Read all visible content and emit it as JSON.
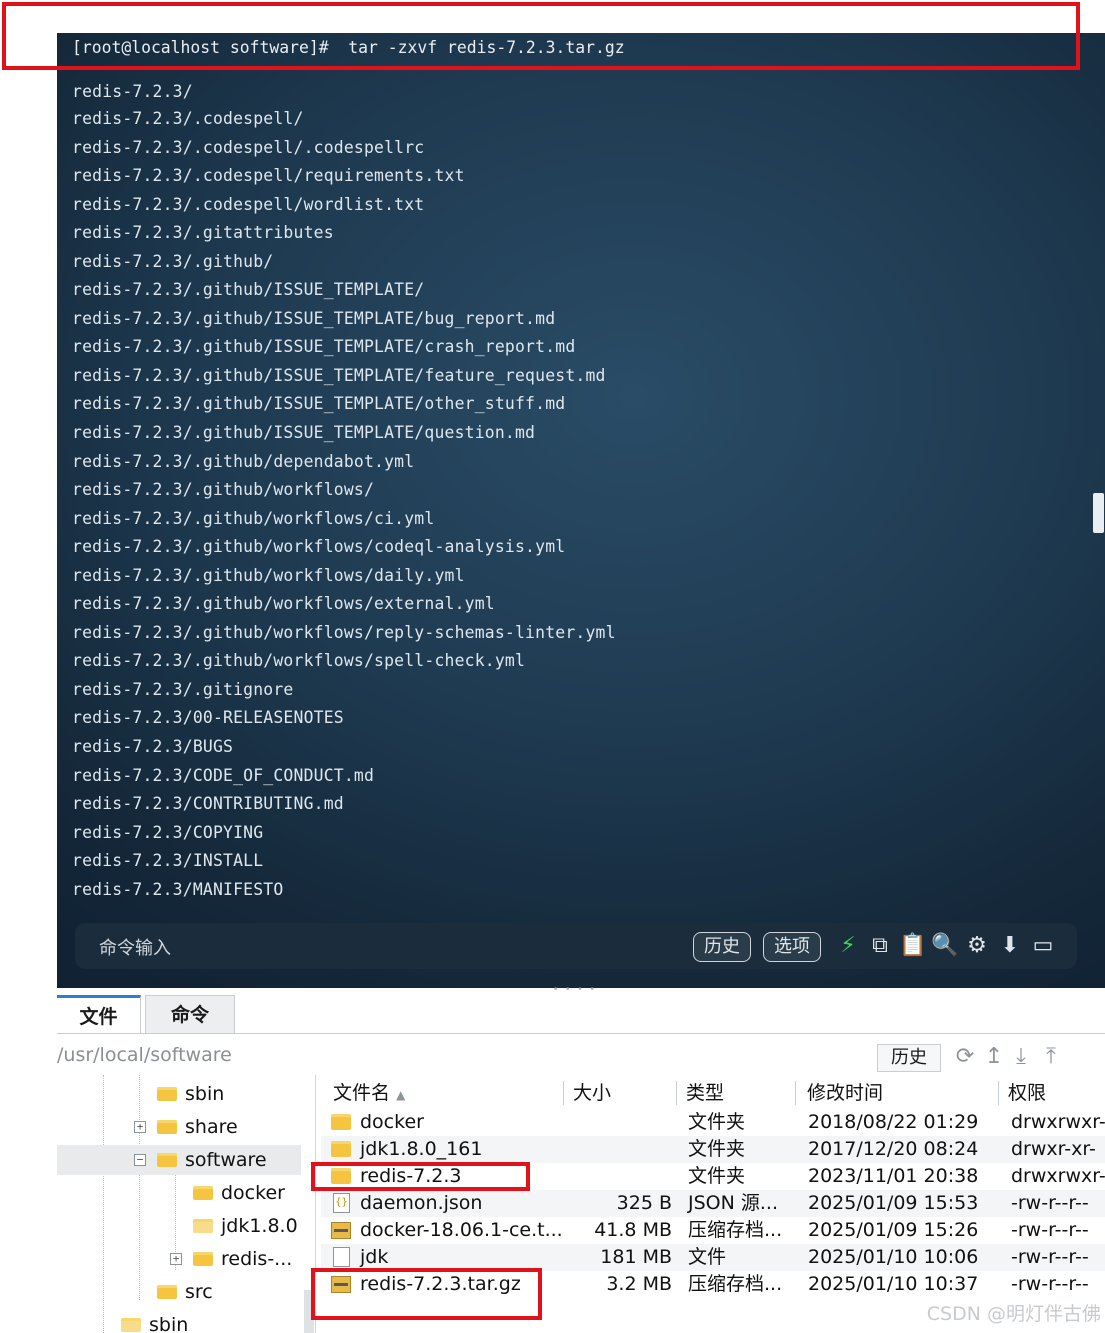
{
  "terminal": {
    "prompt": "[root@localhost software]#  tar -zxvf redis-7.2.3.tar.gz",
    "lines": [
      "redis-7.2.3/",
      "redis-7.2.3/.codespell/",
      "redis-7.2.3/.codespell/.codespellrc",
      "redis-7.2.3/.codespell/requirements.txt",
      "redis-7.2.3/.codespell/wordlist.txt",
      "redis-7.2.3/.gitattributes",
      "redis-7.2.3/.github/",
      "redis-7.2.3/.github/ISSUE_TEMPLATE/",
      "redis-7.2.3/.github/ISSUE_TEMPLATE/bug_report.md",
      "redis-7.2.3/.github/ISSUE_TEMPLATE/crash_report.md",
      "redis-7.2.3/.github/ISSUE_TEMPLATE/feature_request.md",
      "redis-7.2.3/.github/ISSUE_TEMPLATE/other_stuff.md",
      "redis-7.2.3/.github/ISSUE_TEMPLATE/question.md",
      "redis-7.2.3/.github/dependabot.yml",
      "redis-7.2.3/.github/workflows/",
      "redis-7.2.3/.github/workflows/ci.yml",
      "redis-7.2.3/.github/workflows/codeql-analysis.yml",
      "redis-7.2.3/.github/workflows/daily.yml",
      "redis-7.2.3/.github/workflows/external.yml",
      "redis-7.2.3/.github/workflows/reply-schemas-linter.yml",
      "redis-7.2.3/.github/workflows/spell-check.yml",
      "redis-7.2.3/.gitignore",
      "redis-7.2.3/00-RELEASENOTES",
      "redis-7.2.3/BUGS",
      "redis-7.2.3/CODE_OF_CONDUCT.md",
      "redis-7.2.3/CONTRIBUTING.md",
      "redis-7.2.3/COPYING",
      "redis-7.2.3/INSTALL",
      "redis-7.2.3/MANIFESTO"
    ]
  },
  "command_bar": {
    "label": "命令输入",
    "history": "历史",
    "options": "选项",
    "icons": [
      "lightning-icon",
      "copy-icon",
      "paste-icon",
      "search-icon",
      "gear-icon",
      "arrow-down-icon",
      "window-icon"
    ]
  },
  "tabs": [
    {
      "label": "文件",
      "active": true
    },
    {
      "label": "命令",
      "active": false
    }
  ],
  "pathbar": {
    "path": "/usr/local/software",
    "history": "历史",
    "icons": [
      "refresh-icon",
      "up-icon",
      "download-icon",
      "upload-icon"
    ]
  },
  "tree": [
    {
      "label": "sbin",
      "indent": 2,
      "expander": ""
    },
    {
      "label": "share",
      "indent": 2,
      "expander": "+"
    },
    {
      "label": "software",
      "indent": 2,
      "expander": "−",
      "selected": true
    },
    {
      "label": "docker",
      "indent": 3,
      "expander": ""
    },
    {
      "label": "jdk1.8.0",
      "indent": 3,
      "expander": ""
    },
    {
      "label": "redis-...",
      "indent": 3,
      "expander": "+"
    },
    {
      "label": "src",
      "indent": 2,
      "expander": ""
    },
    {
      "label": "sbin",
      "indent": 1,
      "expander": ""
    }
  ],
  "file_list": {
    "columns": [
      "文件名",
      "大小",
      "类型",
      "修改时间",
      "权限"
    ],
    "rows": [
      {
        "name": "docker",
        "size": "",
        "type": "文件夹",
        "modified": "2018/08/22 01:29",
        "perm": "drwxrwxr-",
        "icon": "folder"
      },
      {
        "name": "jdk1.8.0_161",
        "size": "",
        "type": "文件夹",
        "modified": "2017/12/20 08:24",
        "perm": "drwxr-xr-",
        "icon": "folder"
      },
      {
        "name": "redis-7.2.3",
        "size": "",
        "type": "文件夹",
        "modified": "2023/11/01 20:38",
        "perm": "drwxrwxr-",
        "icon": "folder"
      },
      {
        "name": "daemon.json",
        "size": "325 B",
        "type": "JSON 源...",
        "modified": "2025/01/09 15:53",
        "perm": "-rw-r--r--",
        "icon": "json"
      },
      {
        "name": "docker-18.06.1-ce.t...",
        "size": "41.8 MB",
        "type": "压缩存档...",
        "modified": "2025/01/09 15:26",
        "perm": "-rw-r--r--",
        "icon": "archive"
      },
      {
        "name": "jdk",
        "size": "181 MB",
        "type": "文件",
        "modified": "2025/01/10 10:06",
        "perm": "-rw-r--r--",
        "icon": "file"
      },
      {
        "name": "redis-7.2.3.tar.gz",
        "size": "3.2 MB",
        "type": "压缩存档...",
        "modified": "2025/01/10 10:37",
        "perm": "-rw-r--r--",
        "icon": "archive"
      }
    ]
  },
  "watermark": "CSDN @明灯伴古佛",
  "colors": {
    "highlight_box": "#e0121b",
    "tab_accent": "#2b7fd3",
    "folder": "#f5c542"
  }
}
